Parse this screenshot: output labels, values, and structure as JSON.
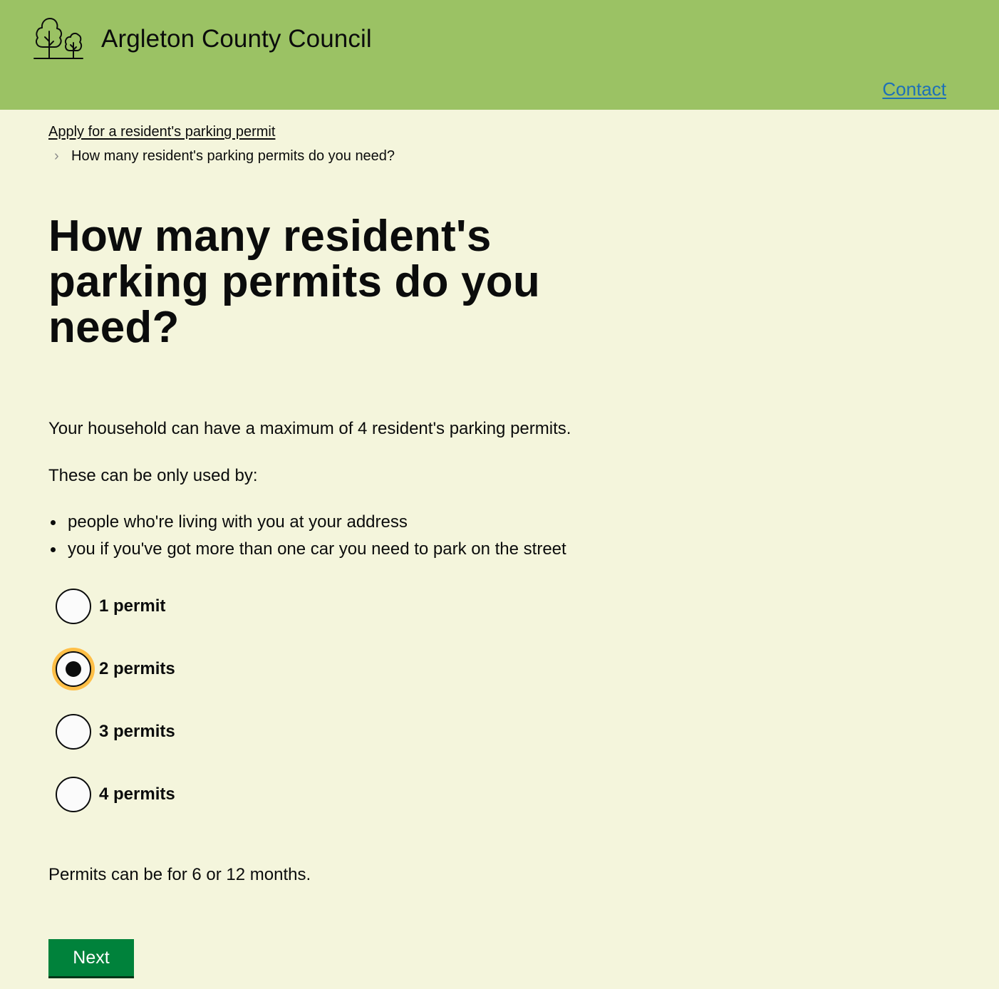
{
  "header": {
    "site_name": "Argleton County Council",
    "logo_icon": "trees-logo-icon",
    "contact_label": "Contact"
  },
  "breadcrumb": {
    "parent_label": "Apply for a resident's parking permit",
    "current_label": "How many resident's parking permits do you need?"
  },
  "main": {
    "title": "How many resident's parking permits do you need?",
    "max_text": "Your household can have a maximum of 4 resident's parking permits.",
    "used_by_text": "These can be only used by:",
    "bullets": [
      "people who're living with you at your address",
      "you if you've got more than one car you need to park on the street"
    ],
    "options": [
      {
        "label": "1 permit",
        "checked": false
      },
      {
        "label": "2 permits",
        "checked": true
      },
      {
        "label": "3 permits",
        "checked": false
      },
      {
        "label": "4 permits",
        "checked": false
      }
    ],
    "months_text": "Permits can be for 6 or 12 months.",
    "next_label": "Next"
  },
  "colors": {
    "header_bg": "#9bc264",
    "page_bg": "#f4f5dc",
    "link": "#1d70b8",
    "button_bg": "#00823b",
    "focus": "#ffbf47",
    "text": "#0b0c0c"
  }
}
